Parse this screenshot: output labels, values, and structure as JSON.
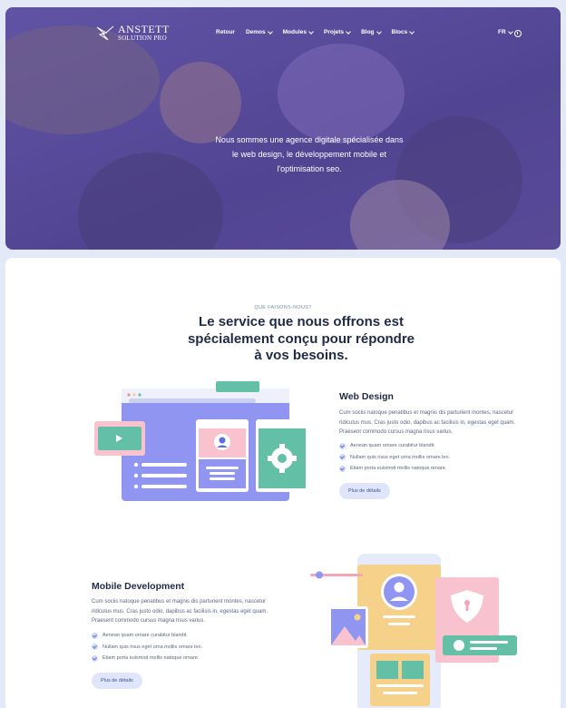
{
  "brand": {
    "name_line1": "ANSTETT",
    "name_line2": "SOLUTION PRO"
  },
  "nav": {
    "items": [
      {
        "label": "Retour",
        "has_caret": false
      },
      {
        "label": "Demos",
        "has_caret": true
      },
      {
        "label": "Modules",
        "has_caret": true
      },
      {
        "label": "Projets",
        "has_caret": true
      },
      {
        "label": "Blog",
        "has_caret": true
      },
      {
        "label": "Blocs",
        "has_caret": true
      }
    ],
    "language": "FR",
    "user_icon": "user-circle-icon"
  },
  "hero": {
    "text": "Nous sommes une agence digitale spécialisée dans le web design, le développement mobile et l'optimisation seo."
  },
  "services": {
    "eyebrow": "QUE FAISONS-NOUS?",
    "heading": "Le service que nous offrons est spécialement conçu pour répondre à vos besoins.",
    "items": [
      {
        "title": "Web Design",
        "description": "Cum sociis natoque penatibus et magnis dis parturient montes, nascetur ridiculus mus. Cras justo odio, dapibus ac facilisis in, egestas eget quam. Praesent commodo cursus magna risus varius.",
        "checks": [
          "Aenean quam ornare curabitur blandit.",
          "Nullam quis risus eget urna mollis ornare leo.",
          "Etiam porta euismod mollis natoque ornare."
        ],
        "button": "Plus de détails"
      },
      {
        "title": "Mobile Development",
        "description": "Cum sociis natoque penatibus et magnis dis parturient montes, nascetur ridiculus mus. Cras justo odio, dapibus ac facilisis in, egestas eget quam. Praesent commodo cursus magna risus varius.",
        "checks": [
          "Aenean quam ornare curabitur blandit.",
          "Nullam quis risus eget urna mollis ornare leo.",
          "Etiam porta euismod mollis natoque ornare."
        ],
        "button": "Plus de détails"
      }
    ]
  },
  "colors": {
    "accent": "#5b6fd6",
    "purple": "#8f95f0",
    "teal": "#63bfa6",
    "pink": "#f8c3cf",
    "yellow": "#f5d18a"
  }
}
